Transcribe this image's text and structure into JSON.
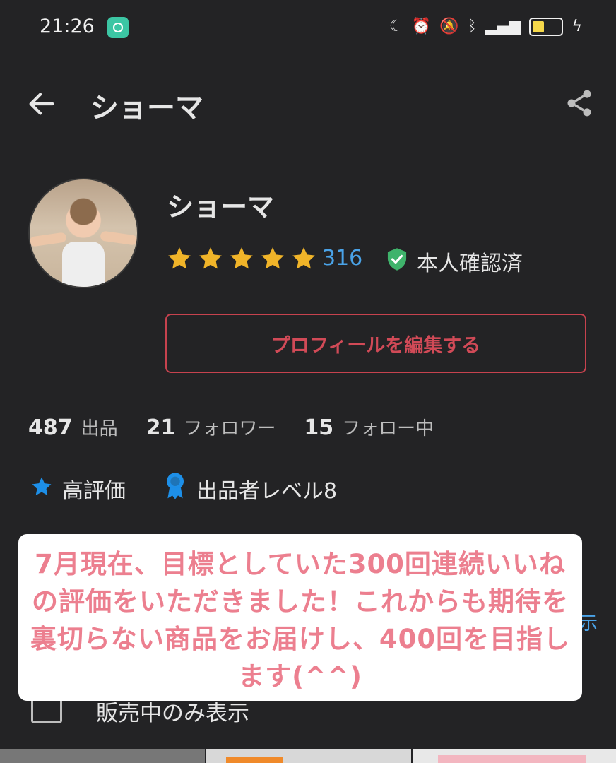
{
  "status_bar": {
    "time": "21:26",
    "icons": [
      "moon-icon",
      "alarm-icon",
      "vibrate-off-icon",
      "bluetooth-icon",
      "volte-icon",
      "signal-4g-icon",
      "battery-icon",
      "charging-icon"
    ]
  },
  "header": {
    "title": "ショーマ"
  },
  "profile": {
    "name": "ショーマ",
    "rating_stars": 5,
    "review_count": "316",
    "verified_label": "本人確認済",
    "edit_button_label": "プロフィールを編集する"
  },
  "stats": {
    "listings_count": "487",
    "listings_label": "出品",
    "followers_count": "21",
    "followers_label": "フォロワー",
    "following_count": "15",
    "following_label": "フォロー中"
  },
  "badges": {
    "high_rating_label": "高評価",
    "seller_level_label": "出品者レベル8"
  },
  "filters": {
    "hidden_link_fragment": "示",
    "on_sale_only_label": "販売中のみ表示"
  },
  "overlay": {
    "message": "7月現在、目標としていた300回連続いいねの評価をいただきました！これからも期待を裏切らない商品をお届けし、400回を目指します(^^)"
  },
  "colors": {
    "background": "#232325",
    "accent_red": "#d14a57",
    "link_blue": "#4aa3e8",
    "star_yellow": "#f0b429",
    "verified_green": "#3fb36b",
    "overlay_text": "#ec7f8f"
  }
}
